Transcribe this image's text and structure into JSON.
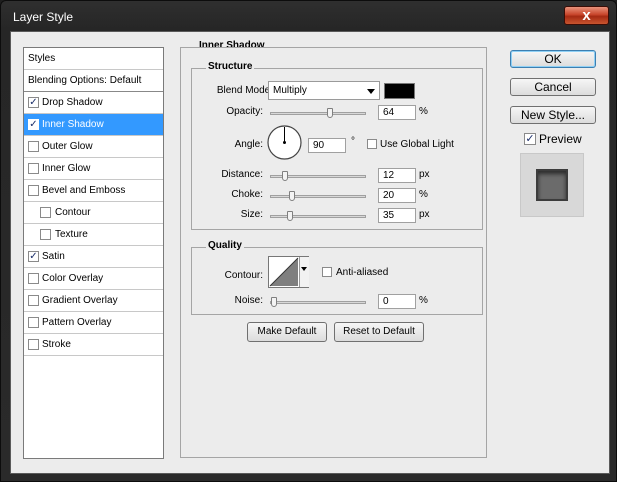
{
  "window": {
    "title": "Layer Style",
    "close_label": "x"
  },
  "left_list": {
    "header": "Styles",
    "blending": "Blending Options: Default",
    "items": [
      {
        "label": "Drop Shadow",
        "checked": true
      },
      {
        "label": "Inner Shadow",
        "checked": true
      },
      {
        "label": "Outer Glow",
        "checked": false
      },
      {
        "label": "Inner Glow",
        "checked": false
      },
      {
        "label": "Bevel and Emboss",
        "checked": false
      },
      {
        "label": "Contour",
        "checked": false
      },
      {
        "label": "Texture",
        "checked": false
      },
      {
        "label": "Satin",
        "checked": true
      },
      {
        "label": "Color Overlay",
        "checked": false
      },
      {
        "label": "Gradient Overlay",
        "checked": false
      },
      {
        "label": "Pattern Overlay",
        "checked": false
      },
      {
        "label": "Stroke",
        "checked": false
      }
    ]
  },
  "panel": {
    "title": "Inner Shadow",
    "structure": {
      "title": "Structure",
      "blend_mode_label": "Blend Mode:",
      "blend_mode_value": "Multiply",
      "blend_color": "#000000",
      "opacity_label": "Opacity:",
      "opacity_value": "64",
      "opacity_unit": "%",
      "opacity_fraction": 0.64,
      "angle_label": "Angle:",
      "angle_value": "90",
      "angle_unit": "°",
      "use_global_light_label": "Use Global Light",
      "use_global_light_checked": false,
      "distance_label": "Distance:",
      "distance_value": "12",
      "distance_unit": "px",
      "distance_fraction": 0.12,
      "choke_label": "Choke:",
      "choke_value": "20",
      "choke_unit": "%",
      "choke_fraction": 0.2,
      "size_label": "Size:",
      "size_value": "35",
      "size_unit": "px",
      "size_fraction": 0.18
    },
    "quality": {
      "title": "Quality",
      "contour_label": "Contour:",
      "anti_aliased_label": "Anti-aliased",
      "anti_aliased_checked": false,
      "noise_label": "Noise:",
      "noise_value": "0",
      "noise_unit": "%",
      "noise_fraction": 0.0
    },
    "make_default": "Make Default",
    "reset_default": "Reset to Default"
  },
  "buttons": {
    "ok": "OK",
    "cancel": "Cancel",
    "new_style": "New Style...",
    "preview_label": "Preview",
    "preview_checked": true
  },
  "colors": {
    "selection": "#3399ff",
    "titlebar": "#2a2a2a",
    "close": "#c8452b"
  }
}
